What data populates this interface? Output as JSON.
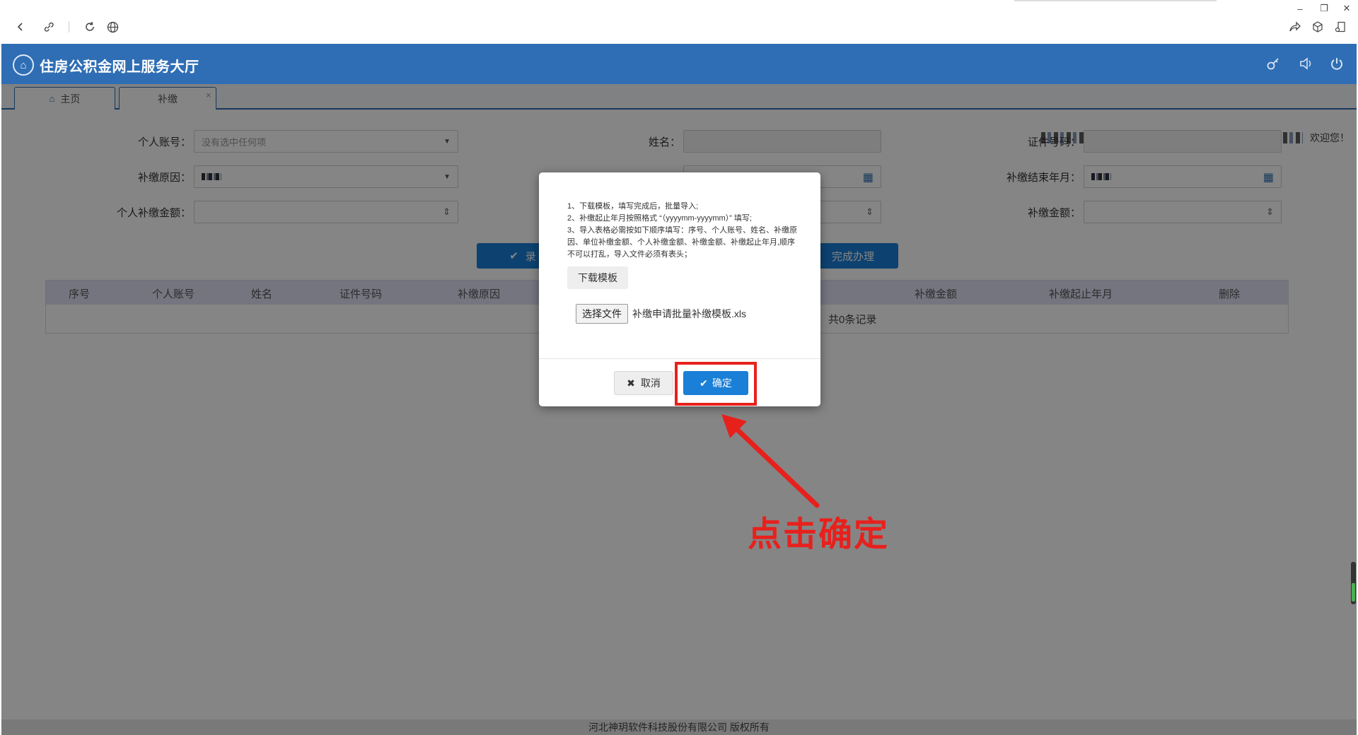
{
  "browser": {
    "win_minimize": "–",
    "win_restore": "❐",
    "win_close": "✕"
  },
  "app": {
    "title": "住房公积金网上服务大厅",
    "tabs": [
      {
        "label": "主页"
      },
      {
        "label": "补缴"
      }
    ],
    "tab_close": "×",
    "welcome": "欢迎您！"
  },
  "form": {
    "account_label": "个人账号：",
    "account_placeholder": "没有选中任何项",
    "name_label": "姓名：",
    "id_label": "证件号码：",
    "reason_label": "补缴原因：",
    "end_month_label": "补缴结束年月：",
    "personal_amount_label": "个人补缴金额：",
    "amount_label": "补缴金额：",
    "submit_label": "录",
    "finish_label": "完成办理"
  },
  "grid": {
    "headers": [
      "序号",
      "个人账号",
      "姓名",
      "证件号码",
      "补缴原因",
      "补缴金额",
      "补缴起止年月",
      "删除"
    ],
    "empty_text": "共0条记录"
  },
  "footer": {
    "copyright": "河北神玥软件科技股份有限公司 版权所有"
  },
  "modal": {
    "instructions": [
      "1、下载模板，填写完成后，批量导入;",
      "2、补缴起止年月按照格式 “（yyyymm-yyyymm）” 填写;",
      "3、导入表格必需按如下顺序填写：序号、个人账号、姓名、补缴原因、单位补缴金额、个人补缴金额、补缴金额、补缴起止年月,顺序不可以打乱，导入文件必须有表头；"
    ],
    "download_template": "下载模板",
    "choose_file": "选择文件",
    "file_name": "补缴申请批量补缴模板.xls",
    "cancel": "取消",
    "confirm": "确定"
  },
  "annotation": {
    "hint": "点击确定",
    "color": "#e8201c"
  },
  "colors": {
    "header_blue": "#2f6eb4",
    "primary_button": "#1a7fd6",
    "annotation_red": "#e8201c"
  }
}
